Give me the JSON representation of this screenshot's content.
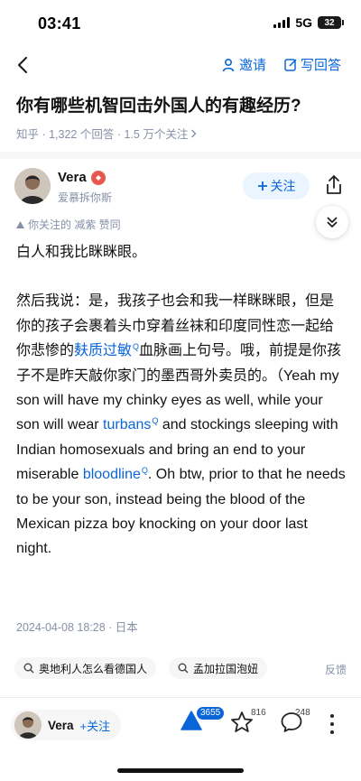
{
  "status_bar": {
    "time": "03:41",
    "network": "5G",
    "battery": "32"
  },
  "nav": {
    "invite_label": "邀请",
    "write_answer_label": "写回答"
  },
  "question": {
    "title": "你有哪些机智回击外国人的有趣经历?",
    "meta": "知乎 · 1,322 个回答 · 1.5 万个关注"
  },
  "author": {
    "name": "Vera",
    "bio": "爱慕拆你斯",
    "follow_label": "关注",
    "liked_by": "你关注的 减紫 赞同"
  },
  "answer": {
    "p1": "白人和我比眯眯眼。",
    "p2_part1": "然后我说：是，我孩子也会和我一样眯眯眼，但是你的孩子会裹着头巾穿着丝袜和印度同性恋一起给你悲惨的",
    "p2_link1": "麸质过敏",
    "p2_part2": "血脉画上句号。哦，前提是你孩子不是昨天敲你家门的墨西哥外卖员的。（Yeah my son will have my chinky eyes as well, while your son will wear ",
    "p2_link2": "turbans",
    "p2_part3": " and stockings sleeping with Indian homosexuals and bring an end to your miserable ",
    "p2_link3": "bloodline",
    "p2_part4": ". Oh btw, prior to that he needs to be your son, instead being the blood of the Mexican pizza boy knocking on your door last night."
  },
  "post_date": "2024-04-08 18:28 · 日本",
  "tags": [
    {
      "label": "奥地利人怎么看德国人"
    },
    {
      "label": "孟加拉国泡妞"
    }
  ],
  "feedback_label": "反馈",
  "bottom_bar": {
    "author_name": "Vera",
    "follow_label": "+关注",
    "vote_count": "3655",
    "favorite_count": "816",
    "comment_count": "248"
  },
  "colors": {
    "accent": "#0a66d8",
    "muted": "#8590a6",
    "badge": "#e8574f"
  },
  "icons": {
    "back": "chevron-left-icon",
    "invite": "person-add-icon",
    "write": "edit-icon",
    "share": "share-icon",
    "collapse": "double-chevron-down-icon",
    "vote": "upvote-triangle-icon",
    "favorite": "star-icon",
    "comment": "comment-bubble-icon",
    "more": "more-vertical-icon"
  }
}
